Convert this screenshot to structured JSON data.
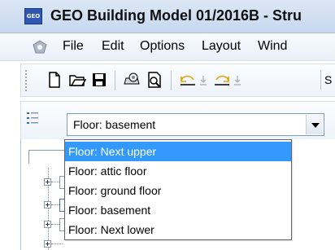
{
  "window": {
    "title": "GEO Building Model  01/2016B - Stru",
    "app_icon_text": "GEO"
  },
  "menu": {
    "items": [
      "File",
      "Edit",
      "Options",
      "Layout",
      "Wind"
    ]
  },
  "toolbar": {
    "partial_label": "S"
  },
  "floor_selector": {
    "value": "Floor: basement",
    "options": [
      "Floor: Next upper",
      "Floor: attic floor",
      "Floor: ground floor",
      "Floor: basement",
      "Floor: Next lower"
    ],
    "highlighted": "Floor: Next upper"
  },
  "colors": {
    "selection": "#3399ff",
    "titlebar": "#c7d8ee"
  }
}
